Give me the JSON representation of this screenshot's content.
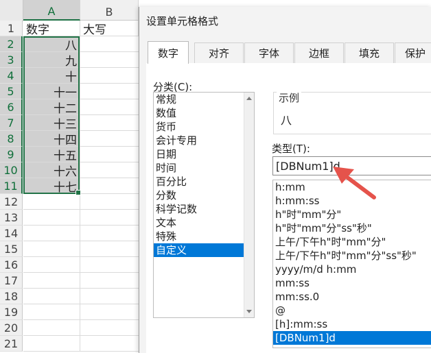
{
  "spreadsheet": {
    "columns": [
      "A",
      "B"
    ],
    "rows": [
      "1",
      "2",
      "3",
      "4",
      "5",
      "6",
      "7",
      "8",
      "9",
      "10",
      "11",
      "12",
      "13",
      "14",
      "15",
      "16",
      "17",
      "18",
      "19",
      "20",
      "21"
    ],
    "header_row": {
      "a": "数字",
      "b": "大写"
    },
    "column_a_values": [
      "八",
      "九",
      "十",
      "十一",
      "十二",
      "十三",
      "十四",
      "十五",
      "十六",
      "十七"
    ]
  },
  "dialog": {
    "title": "设置单元格格式",
    "tabs": [
      "数字",
      "对齐",
      "字体",
      "边框",
      "填充",
      "保护"
    ],
    "active_tab": "数字",
    "category_label": "分类(C):",
    "categories": [
      "常规",
      "数值",
      "货币",
      "会计专用",
      "日期",
      "时间",
      "百分比",
      "分数",
      "科学记数",
      "文本",
      "特殊",
      "自定义"
    ],
    "selected_category": "自定义",
    "sample_label": "示例",
    "sample_value": "八",
    "type_label": "类型(T):",
    "type_input_value": "[DBNum1]d",
    "type_list": [
      "h:mm",
      "h:mm:ss",
      "h\"时\"mm\"分\"",
      "h\"时\"mm\"分\"ss\"秒\"",
      "上午/下午h\"时\"mm\"分\"",
      "上午/下午h\"时\"mm\"分\"ss\"秒\"",
      "yyyy/m/d h:mm",
      "mm:ss",
      "mm:ss.0",
      "@",
      "[h]:mm:ss",
      "[DBNum1]d"
    ],
    "selected_type": "[DBNum1]d"
  },
  "colors": {
    "accent_green": "#217346",
    "selection_blue": "#0078d7",
    "annotation_arrow": "#e5534b"
  }
}
